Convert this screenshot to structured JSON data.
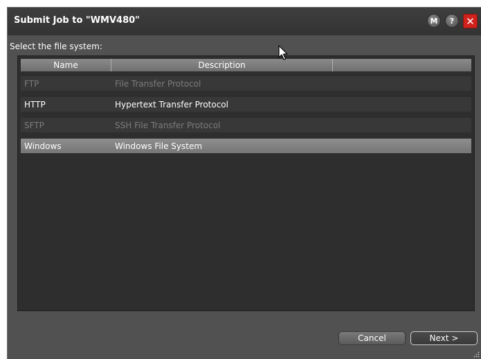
{
  "dialog": {
    "title": "Submit Job to \"WMV480\"",
    "buttons": {
      "manual": "M",
      "help": "?",
      "close": "✕"
    }
  },
  "prompt": "Select the file system:",
  "table": {
    "columns": [
      "Name",
      "Description",
      ""
    ],
    "rows": [
      {
        "name": "FTP",
        "description": "File Transfer Protocol",
        "state": "disabled"
      },
      {
        "name": "HTTP",
        "description": "Hypertext Transfer Protocol",
        "state": "enabled"
      },
      {
        "name": "SFTP",
        "description": "SSH File Transfer Protocol",
        "state": "disabled"
      },
      {
        "name": "Windows",
        "description": "Windows File System",
        "state": "selected"
      }
    ]
  },
  "footer": {
    "cancel_label": "Cancel",
    "next_label": "Next >"
  },
  "colors": {
    "dialog_bg": "#515151",
    "list_bg": "#2e2e2e",
    "close_red": "#d0221c"
  },
  "icons": {
    "cursor": "arrow-cursor-icon",
    "resize": "resize-grip-icon"
  }
}
